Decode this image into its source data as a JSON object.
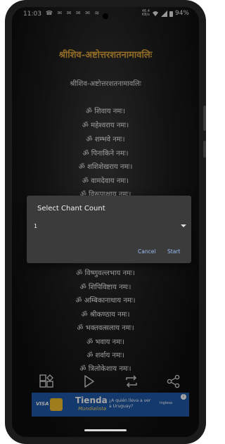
{
  "status_bar": {
    "time": "11:03",
    "left_icons": "☎ ✉ ✉ ✉ ✉ ≋",
    "network_speed_top": "46.4",
    "network_speed_bottom": "KB/s",
    "battery": "94%"
  },
  "page": {
    "title": "श्रीशिव-अष्टोत्तरशतनामावलिः",
    "subtitle": "श्रीशिव-अष्टोत्तरशतनामावलिः",
    "mantras": [
      "ॐ शिवाय नमः।",
      "ॐ महेश्वराय नमः।",
      "ॐ शम्भवे नमः।",
      "ॐ पिनाकिने नमः।",
      "ॐ शशिशेखराय नमः।",
      "ॐ वामदेवाय नमः।",
      "ॐ विरूपाक्षाय नमः।",
      "ॐ विष्णुवल्लभाय नमः।",
      "ॐ शिपिविष्टाय नमः।",
      "ॐ अम्बिकानाथाय नमः।",
      "ॐ श्रीकण्ठाय नमः।",
      "ॐ भक्तवत्सलाय नमः।",
      "ॐ भवाय नमः।",
      "ॐ शर्वाय नमः।",
      "ॐ त्रिलोकेशाय नमः।"
    ]
  },
  "dialog": {
    "title": "Select Chant Count",
    "selected_value": "1",
    "cancel_label": "Cancel",
    "start_label": "Start"
  },
  "toolbar": {
    "icons": [
      "grid-shapes-icon",
      "play-icon",
      "repeat-icon",
      "share-icon"
    ]
  },
  "ad": {
    "visa": "VISA",
    "brand": "Tienda",
    "brand_sub": "Mundialista",
    "question": "¿A quién lleva a ver a Uruguay?",
    "sponsor": "Inglesa"
  },
  "colors": {
    "title_gold": "#e0a63b",
    "dialog_bg": "#3b3b3b",
    "dialog_button": "#9bbcf5",
    "ad_blue": "#1f58a8"
  }
}
